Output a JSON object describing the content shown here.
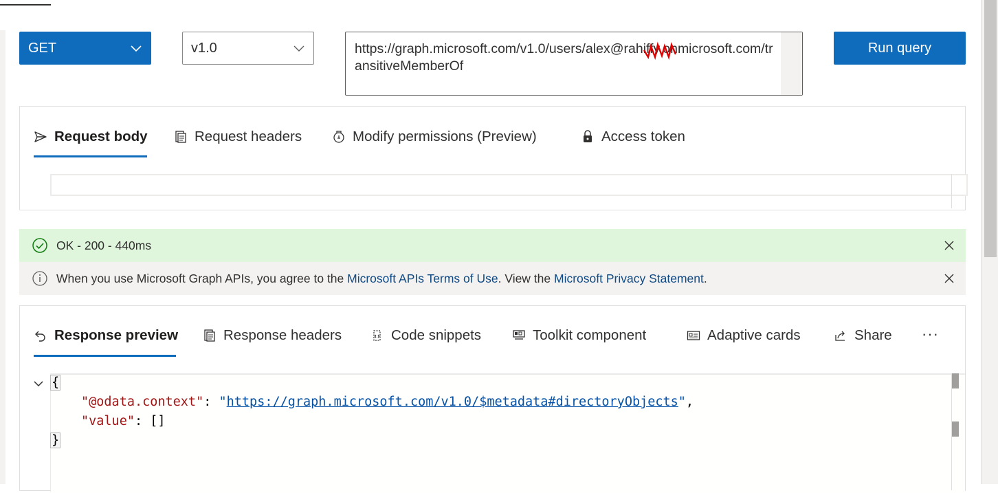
{
  "query": {
    "method": "GET",
    "version": "v1.0",
    "url": "https://graph.microsoft.com/v1.0/users/alex@rahiffy.onmicrosoft.com/transitiveMemberOf",
    "run_label": "Run query"
  },
  "request_tabs": [
    {
      "label": "Request body",
      "icon": "send-icon",
      "active": true
    },
    {
      "label": "Request headers",
      "icon": "headers-icon",
      "active": false
    },
    {
      "label": "Modify permissions (Preview)",
      "icon": "permissions-icon",
      "active": false
    },
    {
      "label": "Access token",
      "icon": "lock-icon",
      "active": false
    }
  ],
  "status": {
    "text": "OK - 200 - 440ms",
    "color": "#dff6dd",
    "icon": "checkmark-circle-icon"
  },
  "terms": {
    "prefix": "When you use Microsoft Graph APIs, you agree to the ",
    "terms_link": "Microsoft APIs Terms of Use",
    "middle": ". View the ",
    "privacy_link": "Microsoft Privacy Statement",
    "suffix": ".",
    "icon": "info-icon"
  },
  "response_tabs": [
    {
      "label": "Response preview",
      "icon": "undo-icon",
      "active": true
    },
    {
      "label": "Response headers",
      "icon": "headers-icon",
      "active": false
    },
    {
      "label": "Code snippets",
      "icon": "code-snippet-icon",
      "active": false
    },
    {
      "label": "Toolkit component",
      "icon": "toolkit-icon",
      "active": false
    },
    {
      "label": "Adaptive cards",
      "icon": "card-icon",
      "active": false
    },
    {
      "label": "Share",
      "icon": "share-icon",
      "active": false
    }
  ],
  "more_label": "···",
  "response": {
    "open_brace": "{",
    "context_key": "\"@odata.context\"",
    "context_value": "https://graph.microsoft.com/v1.0/$metadata#directoryObjects",
    "value_key": "\"value\"",
    "value_value": "[]",
    "close_brace": "}"
  },
  "colors": {
    "accent": "#0f6cbd",
    "success_bg": "#dff6dd",
    "info_bg": "#f3f2f1",
    "json_key": "#a31515",
    "json_string": "#0451a5"
  }
}
